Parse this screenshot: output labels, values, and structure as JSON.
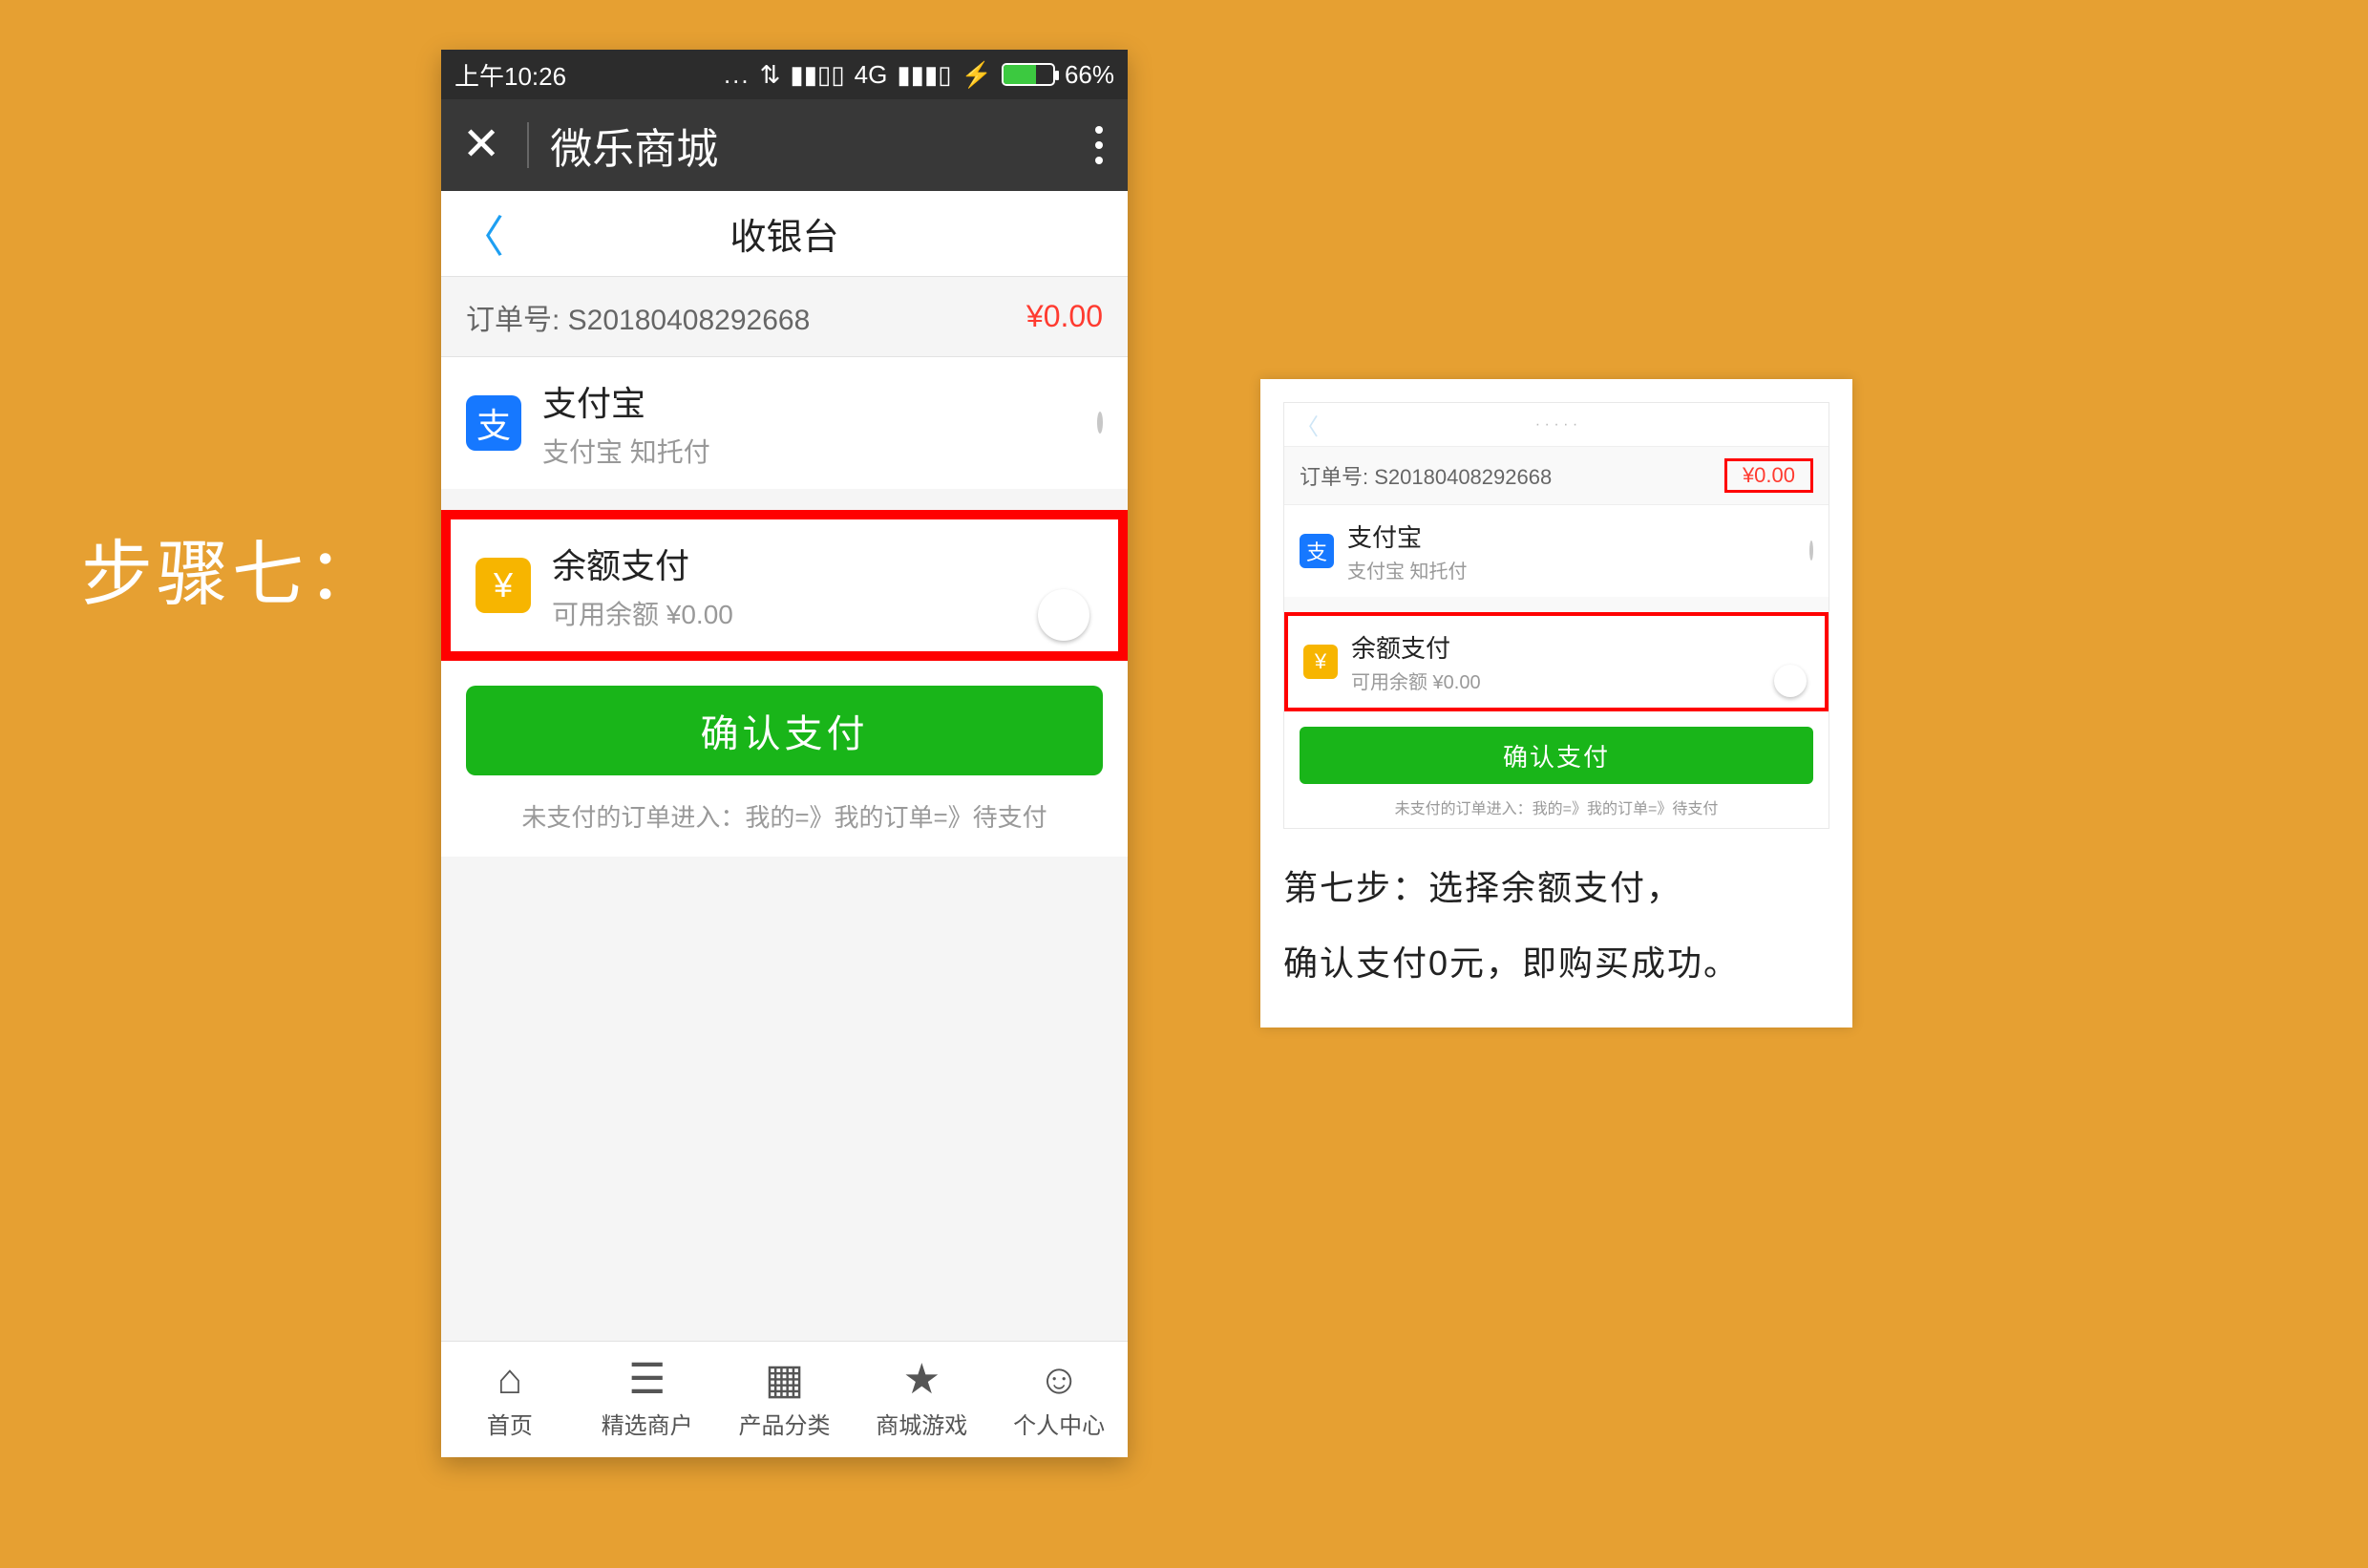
{
  "step_label": "步骤七：",
  "statusbar": {
    "time": "上午10:26",
    "network": "4G",
    "battery_pct": "66%"
  },
  "appbar": {
    "title": "微乐商城"
  },
  "pageheader": {
    "title": "收银台"
  },
  "order": {
    "label_prefix": "订单号: ",
    "number": "S20180408292668",
    "price": "¥0.00"
  },
  "payment_alipay": {
    "icon_glyph": "支",
    "title": "支付宝",
    "subtitle": "支付宝 知托付"
  },
  "payment_balance": {
    "icon_glyph": "¥",
    "title": "余额支付",
    "subtitle": "可用余额 ¥0.00"
  },
  "confirm_label": "确认支付",
  "tip_line": "未支付的订单进入：我的=》我的订单=》待支付",
  "tabs": [
    {
      "label": "首页",
      "glyph": "⌂"
    },
    {
      "label": "精选商户",
      "glyph": "☰"
    },
    {
      "label": "产品分类",
      "glyph": "▦"
    },
    {
      "label": "商城游戏",
      "glyph": "★"
    },
    {
      "label": "个人中心",
      "glyph": "☺"
    }
  ],
  "inset": {
    "order_label_prefix": "订单号: ",
    "order_number": "S20180408292668",
    "price": "¥0.00",
    "alipay_title": "支付宝",
    "alipay_sub": "支付宝 知托付",
    "balance_title": "余额支付",
    "balance_sub": "可用余额 ¥0.00",
    "confirm": "确认支付",
    "tip": "未支付的订单进入：我的=》我的订单=》待支付",
    "caption1": "第七步：选择余额支付，",
    "caption2": "确认支付0元，即购买成功。"
  },
  "colors": {
    "bg": "#e6a032",
    "alipay_blue": "#1678ff",
    "balance_orange": "#f7b500",
    "green": "#19b519",
    "red": "#ff0000"
  }
}
